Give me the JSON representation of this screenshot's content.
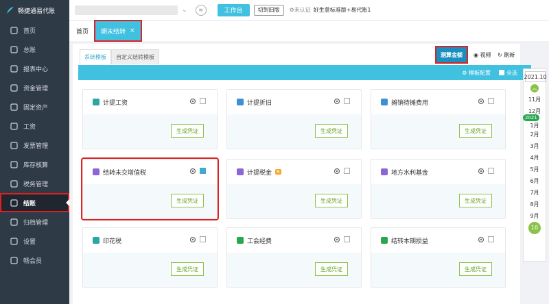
{
  "app": {
    "title": "畅捷通易代账"
  },
  "sidebar": {
    "items": [
      {
        "label": "首页",
        "icon": "home-icon"
      },
      {
        "label": "总账",
        "icon": "ledger-icon"
      },
      {
        "label": "报表中心",
        "icon": "chart-icon"
      },
      {
        "label": "资金管理",
        "icon": "money-icon"
      },
      {
        "label": "固定资产",
        "icon": "asset-icon"
      },
      {
        "label": "工资",
        "icon": "salary-icon"
      },
      {
        "label": "发票管理",
        "icon": "invoice-icon"
      },
      {
        "label": "库存核算",
        "icon": "warehouse-icon"
      },
      {
        "label": "税务管理",
        "icon": "tax-icon"
      },
      {
        "label": "结账",
        "icon": "close-account-icon"
      },
      {
        "label": "归档管理",
        "icon": "archive-icon"
      },
      {
        "label": "设置",
        "icon": "gear-icon"
      },
      {
        "label": "畅会员",
        "icon": "vip-icon"
      }
    ]
  },
  "topbar": {
    "workbench": "工作台",
    "switch_old": "切到旧版",
    "auth": "未认证",
    "plan": "好生意标准版+易代账1"
  },
  "tabs": {
    "home": "首页",
    "current": "期末结转",
    "close": "×"
  },
  "subtabs": {
    "system": "系统模板",
    "custom": "自定义结转模板"
  },
  "toolbar": {
    "calc": "测算金额",
    "view": "视频",
    "refresh": "刷新",
    "config": "模板配置",
    "select_all": "全选"
  },
  "cards": [
    {
      "title": "计提工资",
      "btn": "生成凭证",
      "color": "#2aa6a6",
      "checked": false
    },
    {
      "title": "计提折旧",
      "btn": "生成凭证",
      "color": "#3d8fd8",
      "checked": false
    },
    {
      "title": "摊销待摊费用",
      "btn": "生成凭证",
      "color": "#3d8fd8",
      "checked": false
    },
    {
      "title": "结转未交增值税",
      "btn": "生成凭证",
      "color": "#8a67d6",
      "checked": true
    },
    {
      "title": "计提税金",
      "btn": "生成凭证",
      "color": "#8a67d6",
      "checked": false,
      "badge": "R"
    },
    {
      "title": "地方水利基金",
      "btn": "生成凭证",
      "color": "#8a67d6",
      "checked": false
    },
    {
      "title": "印花税",
      "btn": "生成凭证",
      "color": "#2aa6a6",
      "checked": false
    },
    {
      "title": "工会经费",
      "btn": "生成凭证",
      "color": "#2aa64f",
      "checked": false
    },
    {
      "title": "结转本期损益",
      "btn": "生成凭证",
      "color": "#2aa64f",
      "checked": false
    }
  ],
  "period": {
    "current": "2021.10",
    "months": [
      "11月",
      "12月",
      "1月",
      "2月",
      "3月",
      "4月",
      "5月",
      "6月",
      "7月",
      "8月",
      "9月"
    ],
    "year_badge": "2021",
    "current_month": "10月"
  }
}
